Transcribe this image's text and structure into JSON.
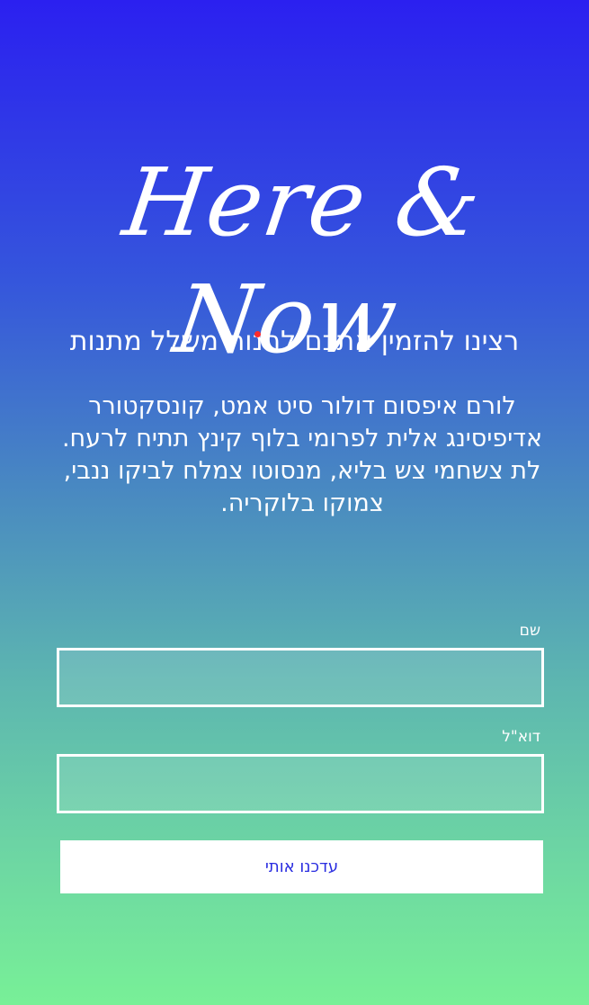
{
  "logo": {
    "text": "Here & Now"
  },
  "invitation": {
    "headline": "רצינו להזמין אתכם להנות משלל מתנות",
    "body": "לורם איפסום דולור סיט אמט, קונסקטורר אדיפיסינג אלית לפרומי בלוף קינץ תתיח לרעח. לת צשחמי צש בליא, מנסוטו צמלח לביקו ננבי, צמוקו בלוקריה."
  },
  "form": {
    "name_label": "שם",
    "name_value": "",
    "email_label": "דוא\"ל",
    "email_value": "",
    "submit_label": "עדכנו אותי"
  },
  "colors": {
    "gradient_top": "#2b20f0",
    "gradient_bottom": "#78f097",
    "button_text": "#2a2de0",
    "accent_dot": "#ff2a2a"
  }
}
